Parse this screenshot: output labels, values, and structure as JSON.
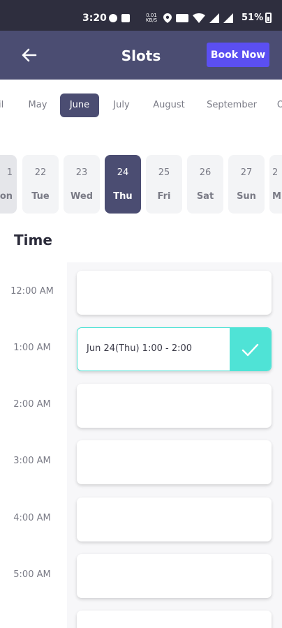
{
  "status_bar": {
    "time": "3:20",
    "data_speed_top": "0.01",
    "data_speed_unit": "KB/S",
    "battery": "51%"
  },
  "header": {
    "back_icon": "arrow-left-icon",
    "title": "Slots",
    "book_now_label": "Book Now"
  },
  "months": [
    "ril",
    "May",
    "June",
    "July",
    "August",
    "September",
    "O"
  ],
  "days": [
    {
      "num": "1",
      "name": "on"
    },
    {
      "num": "22",
      "name": "Tue"
    },
    {
      "num": "23",
      "name": "Wed"
    },
    {
      "num": "24",
      "name": "Thu"
    },
    {
      "num": "25",
      "name": "Fri"
    },
    {
      "num": "26",
      "name": "Sat"
    },
    {
      "num": "27",
      "name": "Sun"
    },
    {
      "num": "2",
      "name": "M"
    }
  ],
  "time_title": "Time",
  "times": [
    "12:00 AM",
    "1:00 AM",
    "2:00 AM",
    "3:00 AM",
    "4:00 AM",
    "5:00 AM"
  ],
  "slots": [
    {
      "label": ""
    },
    {
      "label": "Jun 24(Thu) 1:00 - 2:00"
    },
    {
      "label": ""
    },
    {
      "label": ""
    },
    {
      "label": ""
    },
    {
      "label": ""
    },
    {
      "label": ""
    }
  ],
  "colors": {
    "header_bg": "#4b4d72",
    "accent_button": "#5b4ff2",
    "selected_check": "#4fe3d6"
  }
}
